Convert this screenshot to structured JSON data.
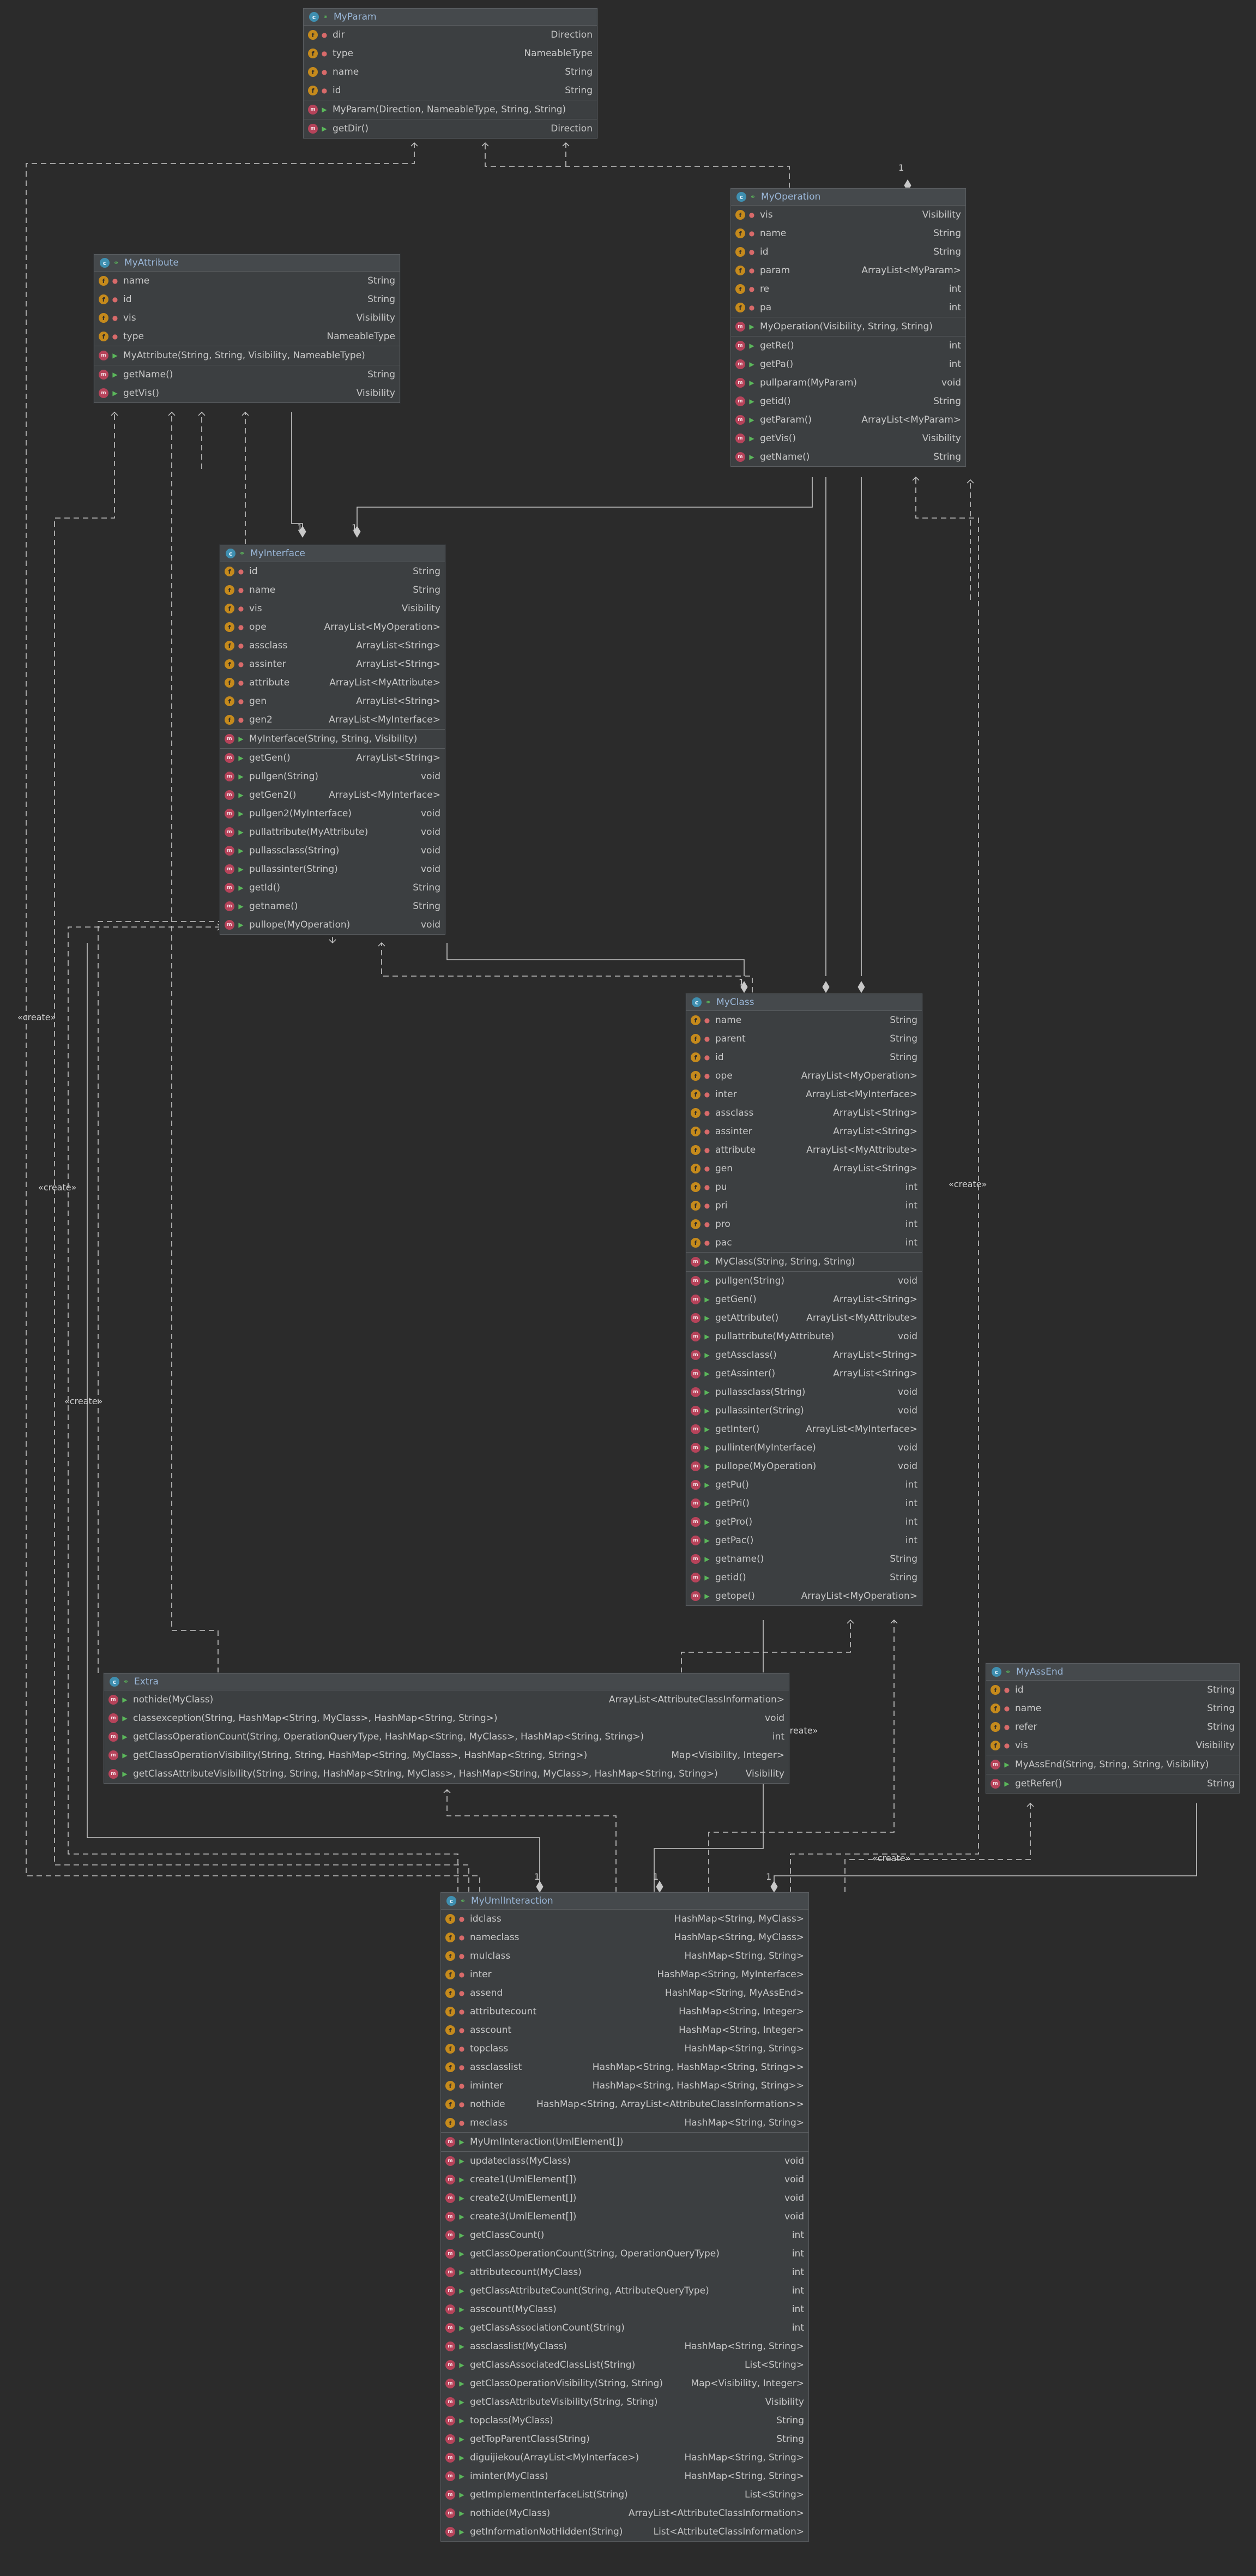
{
  "classes": {
    "MyParam": {
      "name": "MyParam",
      "fields": [
        {
          "name": "dir",
          "type": "Direction"
        },
        {
          "name": "type",
          "type": "NameableType"
        },
        {
          "name": "name",
          "type": "String"
        },
        {
          "name": "id",
          "type": "String"
        }
      ],
      "constructors": [
        {
          "name": "MyParam(Direction, NameableType, String, String)",
          "type": ""
        }
      ],
      "methods": [
        {
          "name": "getDir()",
          "type": "Direction"
        }
      ]
    },
    "MyOperation": {
      "name": "MyOperation",
      "fields": [
        {
          "name": "vis",
          "type": "Visibility"
        },
        {
          "name": "name",
          "type": "String"
        },
        {
          "name": "id",
          "type": "String"
        },
        {
          "name": "param",
          "type": "ArrayList<MyParam>"
        },
        {
          "name": "re",
          "type": "int"
        },
        {
          "name": "pa",
          "type": "int"
        }
      ],
      "constructors": [
        {
          "name": "MyOperation(Visibility, String, String)",
          "type": ""
        }
      ],
      "methods": [
        {
          "name": "getRe()",
          "type": "int"
        },
        {
          "name": "getPa()",
          "type": "int"
        },
        {
          "name": "pullparam(MyParam)",
          "type": "void"
        },
        {
          "name": "getid()",
          "type": "String"
        },
        {
          "name": "getParam()",
          "type": "ArrayList<MyParam>"
        },
        {
          "name": "getVis()",
          "type": "Visibility"
        },
        {
          "name": "getName()",
          "type": "String"
        }
      ]
    },
    "MyAttribute": {
      "name": "MyAttribute",
      "fields": [
        {
          "name": "name",
          "type": "String"
        },
        {
          "name": "id",
          "type": "String"
        },
        {
          "name": "vis",
          "type": "Visibility"
        },
        {
          "name": "type",
          "type": "NameableType"
        }
      ],
      "constructors": [
        {
          "name": "MyAttribute(String, String, Visibility, NameableType)",
          "type": ""
        }
      ],
      "methods": [
        {
          "name": "getName()",
          "type": "String"
        },
        {
          "name": "getVis()",
          "type": "Visibility"
        }
      ]
    },
    "MyInterface": {
      "name": "MyInterface",
      "fields": [
        {
          "name": "id",
          "type": "String"
        },
        {
          "name": "name",
          "type": "String"
        },
        {
          "name": "vis",
          "type": "Visibility"
        },
        {
          "name": "ope",
          "type": "ArrayList<MyOperation>"
        },
        {
          "name": "assclass",
          "type": "ArrayList<String>"
        },
        {
          "name": "assinter",
          "type": "ArrayList<String>"
        },
        {
          "name": "attribute",
          "type": "ArrayList<MyAttribute>"
        },
        {
          "name": "gen",
          "type": "ArrayList<String>"
        },
        {
          "name": "gen2",
          "type": "ArrayList<MyInterface>"
        }
      ],
      "constructors": [
        {
          "name": "MyInterface(String, String, Visibility)",
          "type": ""
        }
      ],
      "methods": [
        {
          "name": "getGen()",
          "type": "ArrayList<String>"
        },
        {
          "name": "pullgen(String)",
          "type": "void"
        },
        {
          "name": "getGen2()",
          "type": "ArrayList<MyInterface>"
        },
        {
          "name": "pullgen2(MyInterface)",
          "type": "void"
        },
        {
          "name": "pullattribute(MyAttribute)",
          "type": "void"
        },
        {
          "name": "pullassclass(String)",
          "type": "void"
        },
        {
          "name": "pullassinter(String)",
          "type": "void"
        },
        {
          "name": "getId()",
          "type": "String"
        },
        {
          "name": "getname()",
          "type": "String"
        },
        {
          "name": "pullope(MyOperation)",
          "type": "void"
        }
      ]
    },
    "MyClass": {
      "name": "MyClass",
      "fields": [
        {
          "name": "name",
          "type": "String"
        },
        {
          "name": "parent",
          "type": "String"
        },
        {
          "name": "id",
          "type": "String"
        },
        {
          "name": "ope",
          "type": "ArrayList<MyOperation>"
        },
        {
          "name": "inter",
          "type": "ArrayList<MyInterface>"
        },
        {
          "name": "assclass",
          "type": "ArrayList<String>"
        },
        {
          "name": "assinter",
          "type": "ArrayList<String>"
        },
        {
          "name": "attribute",
          "type": "ArrayList<MyAttribute>"
        },
        {
          "name": "gen",
          "type": "ArrayList<String>"
        },
        {
          "name": "pu",
          "type": "int"
        },
        {
          "name": "pri",
          "type": "int"
        },
        {
          "name": "pro",
          "type": "int"
        },
        {
          "name": "pac",
          "type": "int"
        }
      ],
      "constructors": [
        {
          "name": "MyClass(String, String, String)",
          "type": ""
        }
      ],
      "methods": [
        {
          "name": "pullgen(String)",
          "type": "void"
        },
        {
          "name": "getGen()",
          "type": "ArrayList<String>"
        },
        {
          "name": "getAttribute()",
          "type": "ArrayList<MyAttribute>"
        },
        {
          "name": "pullattribute(MyAttribute)",
          "type": "void"
        },
        {
          "name": "getAssclass()",
          "type": "ArrayList<String>"
        },
        {
          "name": "getAssinter()",
          "type": "ArrayList<String>"
        },
        {
          "name": "pullassclass(String)",
          "type": "void"
        },
        {
          "name": "pullassinter(String)",
          "type": "void"
        },
        {
          "name": "getInter()",
          "type": "ArrayList<MyInterface>"
        },
        {
          "name": "pullinter(MyInterface)",
          "type": "void"
        },
        {
          "name": "pullope(MyOperation)",
          "type": "void"
        },
        {
          "name": "getPu()",
          "type": "int"
        },
        {
          "name": "getPri()",
          "type": "int"
        },
        {
          "name": "getPro()",
          "type": "int"
        },
        {
          "name": "getPac()",
          "type": "int"
        },
        {
          "name": "getname()",
          "type": "String"
        },
        {
          "name": "getid()",
          "type": "String"
        },
        {
          "name": "getope()",
          "type": "ArrayList<MyOperation>"
        }
      ]
    },
    "Extra": {
      "name": "Extra",
      "fields": [],
      "constructors": [],
      "methods": [
        {
          "name": "nothide(MyClass)",
          "type": "ArrayList<AttributeClassInformation>"
        },
        {
          "name": "classexception(String, HashMap<String, MyClass>, HashMap<String, String>)",
          "type": "void"
        },
        {
          "name": "getClassOperationCount(String, OperationQueryType, HashMap<String, MyClass>, HashMap<String, String>)",
          "type": "int"
        },
        {
          "name": "getClassOperationVisibility(String, String, HashMap<String, MyClass>, HashMap<String, String>)",
          "type": "Map<Visibility, Integer>"
        },
        {
          "name": "getClassAttributeVisibility(String, String, HashMap<String, MyClass>, HashMap<String, MyClass>, HashMap<String, String>)",
          "type": "Visibility"
        }
      ]
    },
    "MyAssEnd": {
      "name": "MyAssEnd",
      "fields": [
        {
          "name": "id",
          "type": "String"
        },
        {
          "name": "name",
          "type": "String"
        },
        {
          "name": "refer",
          "type": "String"
        },
        {
          "name": "vis",
          "type": "Visibility"
        }
      ],
      "constructors": [
        {
          "name": "MyAssEnd(String, String, String, Visibility)",
          "type": ""
        }
      ],
      "methods": [
        {
          "name": "getRefer()",
          "type": "String"
        }
      ]
    },
    "MyUmlInteraction": {
      "name": "MyUmlInteraction",
      "fields": [
        {
          "name": "idclass",
          "type": "HashMap<String, MyClass>"
        },
        {
          "name": "nameclass",
          "type": "HashMap<String, MyClass>"
        },
        {
          "name": "mulclass",
          "type": "HashMap<String, String>"
        },
        {
          "name": "inter",
          "type": "HashMap<String, MyInterface>"
        },
        {
          "name": "assend",
          "type": "HashMap<String, MyAssEnd>"
        },
        {
          "name": "attributecount",
          "type": "HashMap<String, Integer>"
        },
        {
          "name": "asscount",
          "type": "HashMap<String, Integer>"
        },
        {
          "name": "topclass",
          "type": "HashMap<String, String>"
        },
        {
          "name": "assclasslist",
          "type": "HashMap<String, HashMap<String, String>>"
        },
        {
          "name": "iminter",
          "type": "HashMap<String, HashMap<String, String>>"
        },
        {
          "name": "nothide",
          "type": "HashMap<String, ArrayList<AttributeClassInformation>>"
        },
        {
          "name": "meclass",
          "type": "HashMap<String, String>"
        }
      ],
      "constructors": [
        {
          "name": "MyUmlInteraction(UmlElement[])",
          "type": ""
        }
      ],
      "methods": [
        {
          "name": "updateclass(MyClass)",
          "type": "void"
        },
        {
          "name": "create1(UmlElement[])",
          "type": "void"
        },
        {
          "name": "create2(UmlElement[])",
          "type": "void"
        },
        {
          "name": "create3(UmlElement[])",
          "type": "void"
        },
        {
          "name": "getClassCount()",
          "type": "int"
        },
        {
          "name": "getClassOperationCount(String, OperationQueryType)",
          "type": "int"
        },
        {
          "name": "attributecount(MyClass)",
          "type": "int"
        },
        {
          "name": "getClassAttributeCount(String, AttributeQueryType)",
          "type": "int"
        },
        {
          "name": "asscount(MyClass)",
          "type": "int"
        },
        {
          "name": "getClassAssociationCount(String)",
          "type": "int"
        },
        {
          "name": "assclasslist(MyClass)",
          "type": "HashMap<String, String>"
        },
        {
          "name": "getClassAssociatedClassList(String)",
          "type": "List<String>"
        },
        {
          "name": "getClassOperationVisibility(String, String)",
          "type": "Map<Visibility, Integer>"
        },
        {
          "name": "getClassAttributeVisibility(String, String)",
          "type": "Visibility"
        },
        {
          "name": "topclass(MyClass)",
          "type": "String"
        },
        {
          "name": "getTopParentClass(String)",
          "type": "String"
        },
        {
          "name": "diguijiekou(ArrayList<MyInterface>)",
          "type": "HashMap<String, String>"
        },
        {
          "name": "iminter(MyClass)",
          "type": "HashMap<String, String>"
        },
        {
          "name": "getImplementInterfaceList(String)",
          "type": "List<String>"
        },
        {
          "name": "nothide(MyClass)",
          "type": "ArrayList<AttributeClassInformation>"
        },
        {
          "name": "getInformationNotHidden(String)",
          "type": "List<AttributeClassInformation>"
        }
      ]
    }
  },
  "labels": {
    "create": "«create»",
    "one": "1"
  },
  "colors": {
    "background": "#2b2b2b",
    "box": "#3c3f41",
    "line": "#c8c8c8",
    "class_icon": "#3f8fb0",
    "field_icon": "#c58a1c",
    "method_icon": "#b6435a"
  },
  "icons": {
    "class": "class-c-icon",
    "field": "field-f-icon",
    "method": "method-m-icon",
    "private": "lock-icon",
    "public": "unlock-icon"
  }
}
